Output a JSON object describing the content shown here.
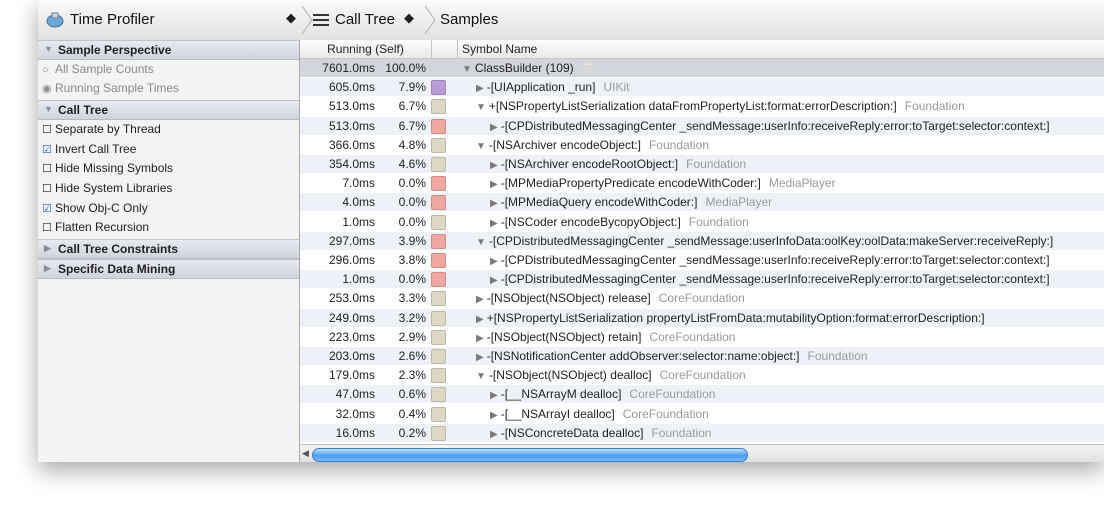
{
  "toolbar": {
    "instrument_label": "Time Profiler",
    "stepper": "◆",
    "call_tree_label": "Call Tree",
    "samples_label": "Samples"
  },
  "sidebar": {
    "sections": [
      {
        "title": "Sample Perspective",
        "expanded": true
      },
      {
        "title": "Call Tree",
        "expanded": true
      },
      {
        "title": "Call Tree Constraints",
        "expanded": false
      },
      {
        "title": "Specific Data Mining",
        "expanded": false
      }
    ],
    "perspective_options": [
      {
        "label": "All Sample Counts",
        "selected": false
      },
      {
        "label": "Running Sample Times",
        "selected": true
      }
    ],
    "call_tree_options": [
      {
        "label": "Separate by Thread",
        "checked": false
      },
      {
        "label": "Invert Call Tree",
        "checked": true
      },
      {
        "label": "Hide Missing Symbols",
        "checked": false
      },
      {
        "label": "Hide System Libraries",
        "checked": false
      },
      {
        "label": "Show Obj-C Only",
        "checked": true
      },
      {
        "label": "Flatten Recursion",
        "checked": false
      }
    ]
  },
  "table": {
    "columns": {
      "running": "Running (Self)",
      "symbol": "Symbol Name"
    },
    "rows": [
      {
        "time": "7601.0ms",
        "pct": "100.0%",
        "icon": "none",
        "indent": 0,
        "disclosure": "open",
        "symbol": "ClassBuilder (109)",
        "library": ""
      },
      {
        "time": "605.0ms",
        "pct": "7.9%",
        "icon": "app-icon",
        "indent": 1,
        "disclosure": "closed",
        "symbol": "-[UIApplication _run]",
        "library": "UIKit"
      },
      {
        "time": "513.0ms",
        "pct": "6.7%",
        "icon": "framework-icon",
        "indent": 1,
        "disclosure": "open",
        "symbol": "+[NSPropertyListSerialization dataFromPropertyList:format:errorDescription:]",
        "library": "Foundation"
      },
      {
        "time": "513.0ms",
        "pct": "6.7%",
        "icon": "toolbox-icon",
        "indent": 2,
        "disclosure": "closed",
        "symbol": "-[CPDistributedMessagingCenter _sendMessage:userInfo:receiveReply:error:toTarget:selector:context:]",
        "library": ""
      },
      {
        "time": "366.0ms",
        "pct": "4.8%",
        "icon": "framework-icon",
        "indent": 1,
        "disclosure": "open",
        "symbol": "-[NSArchiver encodeObject:]",
        "library": "Foundation"
      },
      {
        "time": "354.0ms",
        "pct": "4.6%",
        "icon": "framework-icon",
        "indent": 2,
        "disclosure": "closed",
        "symbol": "-[NSArchiver encodeRootObject:]",
        "library": "Foundation"
      },
      {
        "time": "7.0ms",
        "pct": "0.0%",
        "icon": "toolbox-icon",
        "indent": 2,
        "disclosure": "closed",
        "symbol": "-[MPMediaPropertyPredicate encodeWithCoder:]",
        "library": "MediaPlayer"
      },
      {
        "time": "4.0ms",
        "pct": "0.0%",
        "icon": "toolbox-icon",
        "indent": 2,
        "disclosure": "closed",
        "symbol": "-[MPMediaQuery encodeWithCoder:]",
        "library": "MediaPlayer"
      },
      {
        "time": "1.0ms",
        "pct": "0.0%",
        "icon": "framework-icon",
        "indent": 2,
        "disclosure": "closed",
        "symbol": "-[NSCoder encodeBycopyObject:]",
        "library": "Foundation"
      },
      {
        "time": "297.0ms",
        "pct": "3.9%",
        "icon": "toolbox-icon",
        "indent": 1,
        "disclosure": "open",
        "symbol": "-[CPDistributedMessagingCenter _sendMessage:userInfoData:oolKey:oolData:makeServer:receiveReply:]",
        "library": ""
      },
      {
        "time": "296.0ms",
        "pct": "3.8%",
        "icon": "toolbox-icon",
        "indent": 2,
        "disclosure": "closed",
        "symbol": "-[CPDistributedMessagingCenter _sendMessage:userInfo:receiveReply:error:toTarget:selector:context:]",
        "library": ""
      },
      {
        "time": "1.0ms",
        "pct": "0.0%",
        "icon": "toolbox-icon",
        "indent": 2,
        "disclosure": "closed",
        "symbol": "-[CPDistributedMessagingCenter _sendMessage:userInfo:receiveReply:error:toTarget:selector:context:]",
        "library": ""
      },
      {
        "time": "253.0ms",
        "pct": "3.3%",
        "icon": "framework-icon",
        "indent": 1,
        "disclosure": "closed",
        "symbol": "-[NSObject(NSObject) release]",
        "library": "CoreFoundation"
      },
      {
        "time": "249.0ms",
        "pct": "3.2%",
        "icon": "framework-icon",
        "indent": 1,
        "disclosure": "closed",
        "symbol": "+[NSPropertyListSerialization propertyListFromData:mutabilityOption:format:errorDescription:]",
        "library": ""
      },
      {
        "time": "223.0ms",
        "pct": "2.9%",
        "icon": "framework-icon",
        "indent": 1,
        "disclosure": "closed",
        "symbol": "-[NSObject(NSObject) retain]",
        "library": "CoreFoundation"
      },
      {
        "time": "203.0ms",
        "pct": "2.6%",
        "icon": "framework-icon",
        "indent": 1,
        "disclosure": "closed",
        "symbol": "-[NSNotificationCenter addObserver:selector:name:object:]",
        "library": "Foundation"
      },
      {
        "time": "179.0ms",
        "pct": "2.3%",
        "icon": "framework-icon",
        "indent": 1,
        "disclosure": "open",
        "symbol": "-[NSObject(NSObject) dealloc]",
        "library": "CoreFoundation"
      },
      {
        "time": "47.0ms",
        "pct": "0.6%",
        "icon": "framework-icon",
        "indent": 2,
        "disclosure": "closed",
        "symbol": "-[__NSArrayM dealloc]",
        "library": "CoreFoundation"
      },
      {
        "time": "32.0ms",
        "pct": "0.4%",
        "icon": "framework-icon",
        "indent": 2,
        "disclosure": "closed",
        "symbol": "-[__NSArrayI dealloc]",
        "library": "CoreFoundation"
      },
      {
        "time": "16.0ms",
        "pct": "0.2%",
        "icon": "framework-icon",
        "indent": 2,
        "disclosure": "closed",
        "symbol": "-[NSConcreteData dealloc]",
        "library": "Foundation"
      }
    ]
  },
  "scrollbar": {
    "visible_fraction": 0.55
  },
  "colors": {
    "framework": "#ddd7c4",
    "toolbox": "#f0a7a0",
    "app": "#b89cd8",
    "row_alt": "#eef2f8",
    "scroll_thumb": "#4a9df0"
  }
}
